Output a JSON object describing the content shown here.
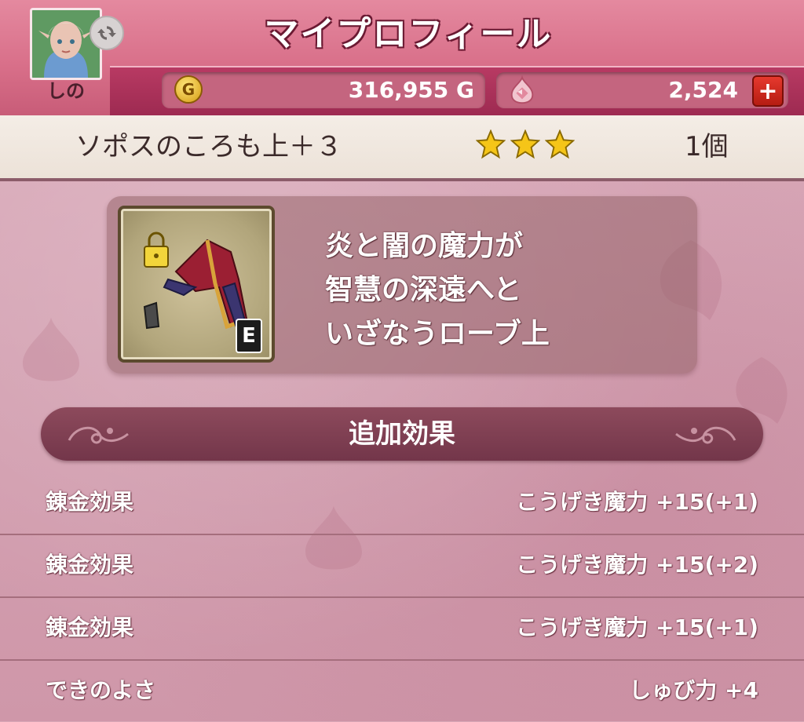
{
  "header": {
    "title": "マイプロフィール",
    "player_name": "しの",
    "gold": "316,955 G",
    "gold_icon_letter": "G",
    "gems": "2,524",
    "add_gem_label": "+",
    "refresh_icon": "refresh-icon"
  },
  "item": {
    "name": "ソポスのころも上＋３",
    "stars": 3,
    "count": "1個",
    "equipped_badge": "E",
    "description_lines": [
      "炎と闇の魔力が",
      "智慧の深遠へと",
      "いざなうローブ上"
    ]
  },
  "effects": {
    "title": "追加効果",
    "rows": [
      {
        "label": "錬金効果",
        "value": "こうげき魔力 +15(+1)"
      },
      {
        "label": "錬金効果",
        "value": "こうげき魔力 +15(+2)"
      },
      {
        "label": "錬金効果",
        "value": "こうげき魔力 +15(+1)"
      },
      {
        "label": "できのよさ",
        "value": "しゅび力 +4"
      }
    ]
  },
  "colors": {
    "header_pink": "#d9708a",
    "band_crimson": "#9d2a51",
    "panel_bg": "#ece2d8",
    "section_header": "#7d3d50",
    "star_gold": "#f5c518"
  }
}
